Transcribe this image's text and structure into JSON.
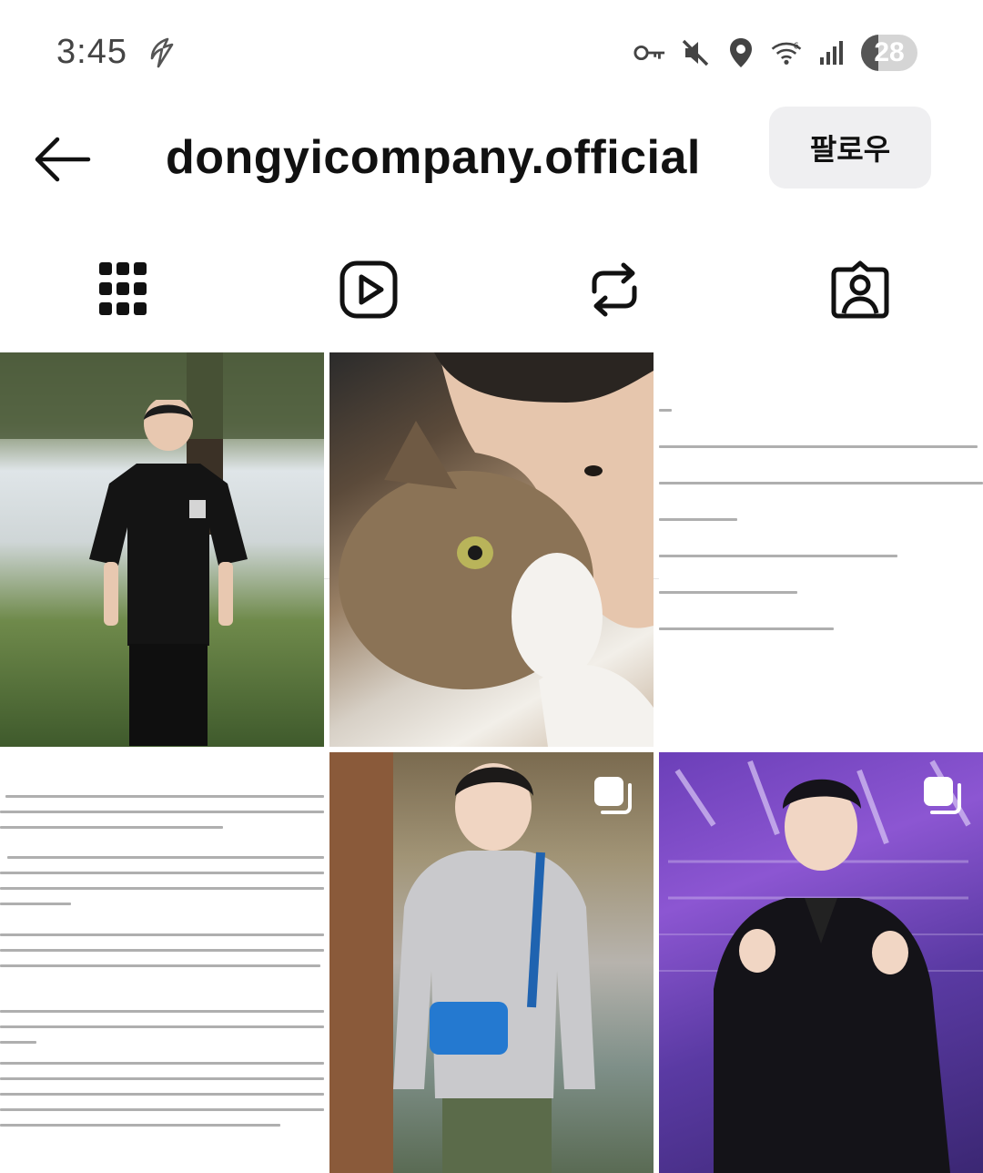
{
  "status_bar": {
    "time": "3:45",
    "icons": [
      "messenger-bolt-icon",
      "vpn-key-icon",
      "mute-icon",
      "location-icon",
      "wifi-icon",
      "signal-icon"
    ],
    "battery_level": "28"
  },
  "header": {
    "back_icon": "arrow-left-icon",
    "username": "dongyicompany.official",
    "follow_label": "팔로우"
  },
  "tabs": [
    {
      "name": "posts",
      "icon": "grid-icon",
      "active": true
    },
    {
      "name": "reels",
      "icon": "reels-icon",
      "active": false
    },
    {
      "name": "reposts",
      "icon": "repost-icon",
      "active": false
    },
    {
      "name": "tagged",
      "icon": "tagged-user-icon",
      "active": false
    }
  ],
  "grid": [
    {
      "kind": "photo",
      "subject": "man-under-tree",
      "multi": false
    },
    {
      "kind": "photo",
      "subject": "man-with-cat",
      "multi": false
    },
    {
      "kind": "text-post",
      "subject": "apology-letter",
      "multi": false
    },
    {
      "kind": "text-post",
      "subject": "apology-statement",
      "multi": false
    },
    {
      "kind": "photo",
      "subject": "man-with-blue-bag",
      "multi": true
    },
    {
      "kind": "photo",
      "subject": "man-at-awards",
      "multi": true
    }
  ],
  "colors": {
    "accent": "#111111",
    "follow_bg": "#efeff1",
    "award_bg": "#7a4cc8"
  }
}
